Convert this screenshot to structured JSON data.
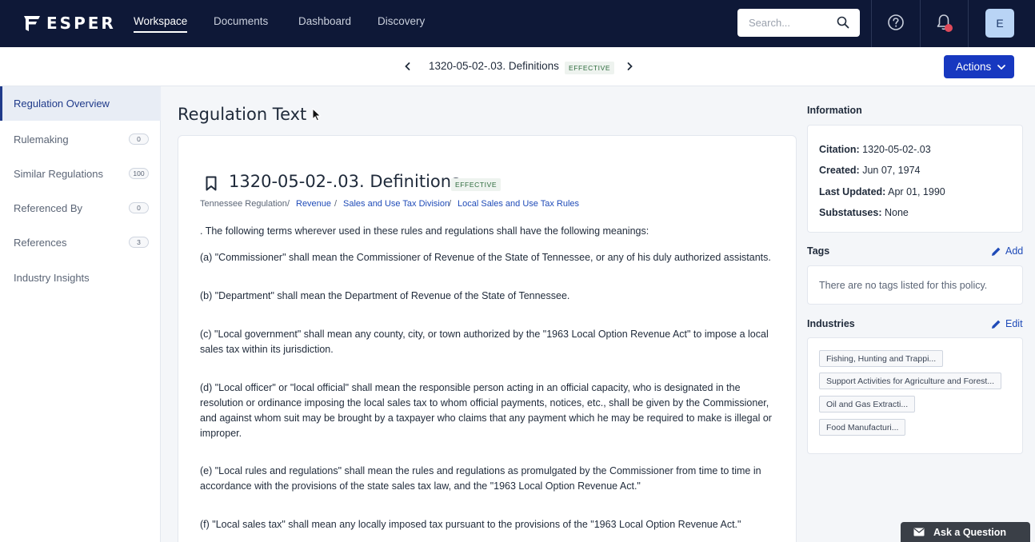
{
  "brand": {
    "name": "ESPER"
  },
  "nav": {
    "items": [
      {
        "label": "Workspace",
        "active": true
      },
      {
        "label": "Documents",
        "active": false
      },
      {
        "label": "Dashboard",
        "active": false
      },
      {
        "label": "Discovery",
        "active": false
      }
    ],
    "search_placeholder": "Search...",
    "avatar_initial": "E"
  },
  "subheader": {
    "title": "1320-05-02-.03. Definitions",
    "status": "EFFECTIVE",
    "actions_label": "Actions"
  },
  "sidebar": {
    "items": [
      {
        "label": "Regulation Overview",
        "count": null,
        "active": true
      },
      {
        "label": "Rulemaking",
        "count": "0"
      },
      {
        "label": "Similar Regulations",
        "count": "100"
      },
      {
        "label": "Referenced By",
        "count": "0"
      },
      {
        "label": "References",
        "count": "3"
      },
      {
        "label": "Industry Insights",
        "count": null
      }
    ]
  },
  "main": {
    "heading": "Regulation Text",
    "doc_title": "1320-05-02-.03. Definitions",
    "doc_status": "EFFECTIVE",
    "breadcrumb": [
      "Tennessee Regulation",
      "Revenue",
      "Sales and Use Tax Division",
      "Local Sales and Use Tax Rules"
    ],
    "paragraphs": [
      ". The following terms wherever used in these rules and regulations shall have the following meanings:",
      "(a) \"Commissioner\" shall mean the Commissioner of Revenue of the State of Tennessee, or any of his duly authorized assistants.",
      "(b) \"Department\" shall mean the Department of Revenue of the State of Tennessee.",
      "(c) \"Local government\" shall mean any county, city, or town authorized by the \"1963 Local Option Revenue Act\" to impose a local sales tax within its jurisdiction.",
      "(d) \"Local officer\" or \"local official\" shall mean the responsible person acting in an official capacity, who is designated in the resolution or ordinance imposing the local sales tax to whom official payments, notices, etc., shall be given by the Commissioner, and against whom suit may be brought by a taxpayer who claims that any payment which he may be required to make is illegal or improper.",
      "(e) \"Local rules and regulations\" shall mean the rules and regulations as promulgated by the Commissioner from time to time in accordance with the provisions of the state sales tax law, and the \"1963 Local Option Revenue Act.\"",
      "(f) \"Local sales tax\" shall mean any locally imposed tax pursuant to the provisions of the \"1963 Local Option Revenue Act.\""
    ]
  },
  "info": {
    "heading": "Information",
    "citation_label": "Citation:",
    "citation": "1320-05-02-.03",
    "created_label": "Created:",
    "created": "Jun 07, 1974",
    "updated_label": "Last Updated:",
    "updated": "Apr 01, 1990",
    "substatuses_label": "Substatuses:",
    "substatuses": "None"
  },
  "tags": {
    "heading": "Tags",
    "add_label": "Add",
    "empty_text": "There are no tags listed for this policy."
  },
  "industries": {
    "heading": "Industries",
    "edit_label": "Edit",
    "items": [
      "Fishing, Hunting and Trappi...",
      "Support Activities for Agriculture and Forest...",
      "Oil and Gas Extracti...",
      "Food Manufacturi..."
    ]
  },
  "ask": {
    "label": "Ask a Question"
  },
  "colors": {
    "navbar": "#0e1837",
    "primary": "#1738c0",
    "link": "#1f4bb8",
    "notification": "#e04a5b"
  }
}
